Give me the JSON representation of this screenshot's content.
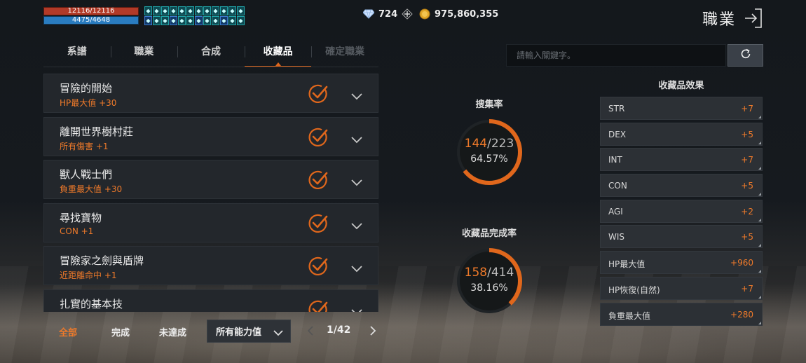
{
  "player": {
    "hp": "12116/12116",
    "mp": "4475/4648",
    "hp_color": "#b23a28",
    "mp_color": "#2a7cc0",
    "buff_icons": [
      "shield",
      "heart",
      "wind",
      "leaf",
      "sword",
      "bolt",
      "arrow",
      "star",
      "feather",
      "tree",
      "shield",
      "drop",
      "fire",
      "eye",
      "cross",
      "bone",
      "orb",
      "gem",
      "wings",
      "wolf",
      "ice",
      "flag",
      "skull",
      "sun"
    ]
  },
  "currency": {
    "diamonds": "724",
    "gold": "975,860,355"
  },
  "header": {
    "title": "職業"
  },
  "tabs": [
    {
      "label": "系譜",
      "state": "normal"
    },
    {
      "label": "職業",
      "state": "normal"
    },
    {
      "label": "合成",
      "state": "normal"
    },
    {
      "label": "收藏品",
      "state": "active"
    },
    {
      "label": "確定職業",
      "state": "disabled"
    }
  ],
  "search": {
    "placeholder": "請輸入關鍵字。"
  },
  "collections": [
    {
      "title": "冒險的開始",
      "effect": "HP最大值 +30",
      "completed": true
    },
    {
      "title": "離開世界樹村莊",
      "effect": "所有傷害 +1",
      "completed": true
    },
    {
      "title": "獸人戰士們",
      "effect": "負重最大值 +30",
      "completed": true
    },
    {
      "title": "尋找寶物",
      "effect": "CON +1",
      "completed": true
    },
    {
      "title": "冒險家之劍與盾牌",
      "effect": "近距離命中 +1",
      "completed": true
    },
    {
      "title": "扎實的基本技",
      "effect": "",
      "completed": true
    }
  ],
  "filters": {
    "all": "全部",
    "done": "完成",
    "undone": "未達成",
    "ability_select": "所有能力值"
  },
  "pager": {
    "text": "1/42"
  },
  "gauges": {
    "collect": {
      "label": "搜集率",
      "count": "144",
      "total": "/223",
      "percent": "64.57%",
      "fraction": 0.6457
    },
    "complete": {
      "label": "收藏品完成率",
      "count": "158",
      "total": "/414",
      "percent": "38.16%",
      "fraction": 0.3816
    }
  },
  "effects": {
    "title": "收藏品效果",
    "items": [
      {
        "name": "STR",
        "value": "+7"
      },
      {
        "name": "DEX",
        "value": "+5"
      },
      {
        "name": "INT",
        "value": "+7"
      },
      {
        "name": "CON",
        "value": "+5"
      },
      {
        "name": "AGI",
        "value": "+2"
      },
      {
        "name": "WIS",
        "value": "+5"
      },
      {
        "name": "HP最大值",
        "value": "+960"
      },
      {
        "name": "HP恢復(自然)",
        "value": "+7"
      },
      {
        "name": "負重最大值",
        "value": "+280"
      }
    ]
  },
  "colors": {
    "accent": "#ef7a2a",
    "panel": "#23272c"
  }
}
